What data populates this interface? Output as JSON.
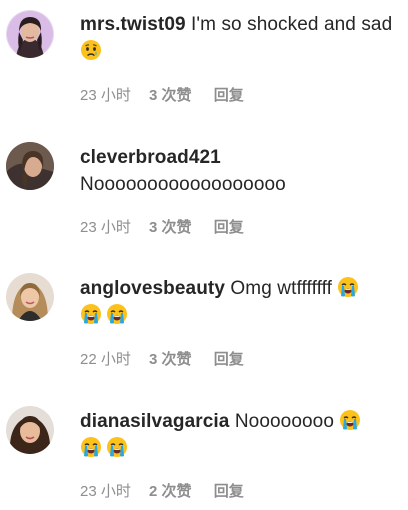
{
  "comments": [
    {
      "username": "mrs.twist09",
      "text": "I'm so shocked and sad",
      "emoji": "sad-face-icon",
      "time": "23 小时",
      "likes": "3 次赞",
      "reply": "回复"
    },
    {
      "username": "cleverbroad421",
      "text": "Noooooooooooooooooo",
      "time": "23 小时",
      "likes": "3 次赞",
      "reply": "回复"
    },
    {
      "username": "anglovesbeauty",
      "text": "Omg wtfffffff",
      "emoji": "crying-face-icon",
      "time": "22 小时",
      "likes": "3 次赞",
      "reply": "回复"
    },
    {
      "username": "dianasilvagarcia",
      "text": "Noooooooo",
      "emoji": "crying-face-icon",
      "time": "23 小时",
      "likes": "2 次赞",
      "reply": "回复"
    }
  ],
  "colors": {
    "text": "#262626",
    "meta": "#8e8e8e",
    "emoji_face": "#fcc21b",
    "emoji_tears": "#29a7e2"
  }
}
